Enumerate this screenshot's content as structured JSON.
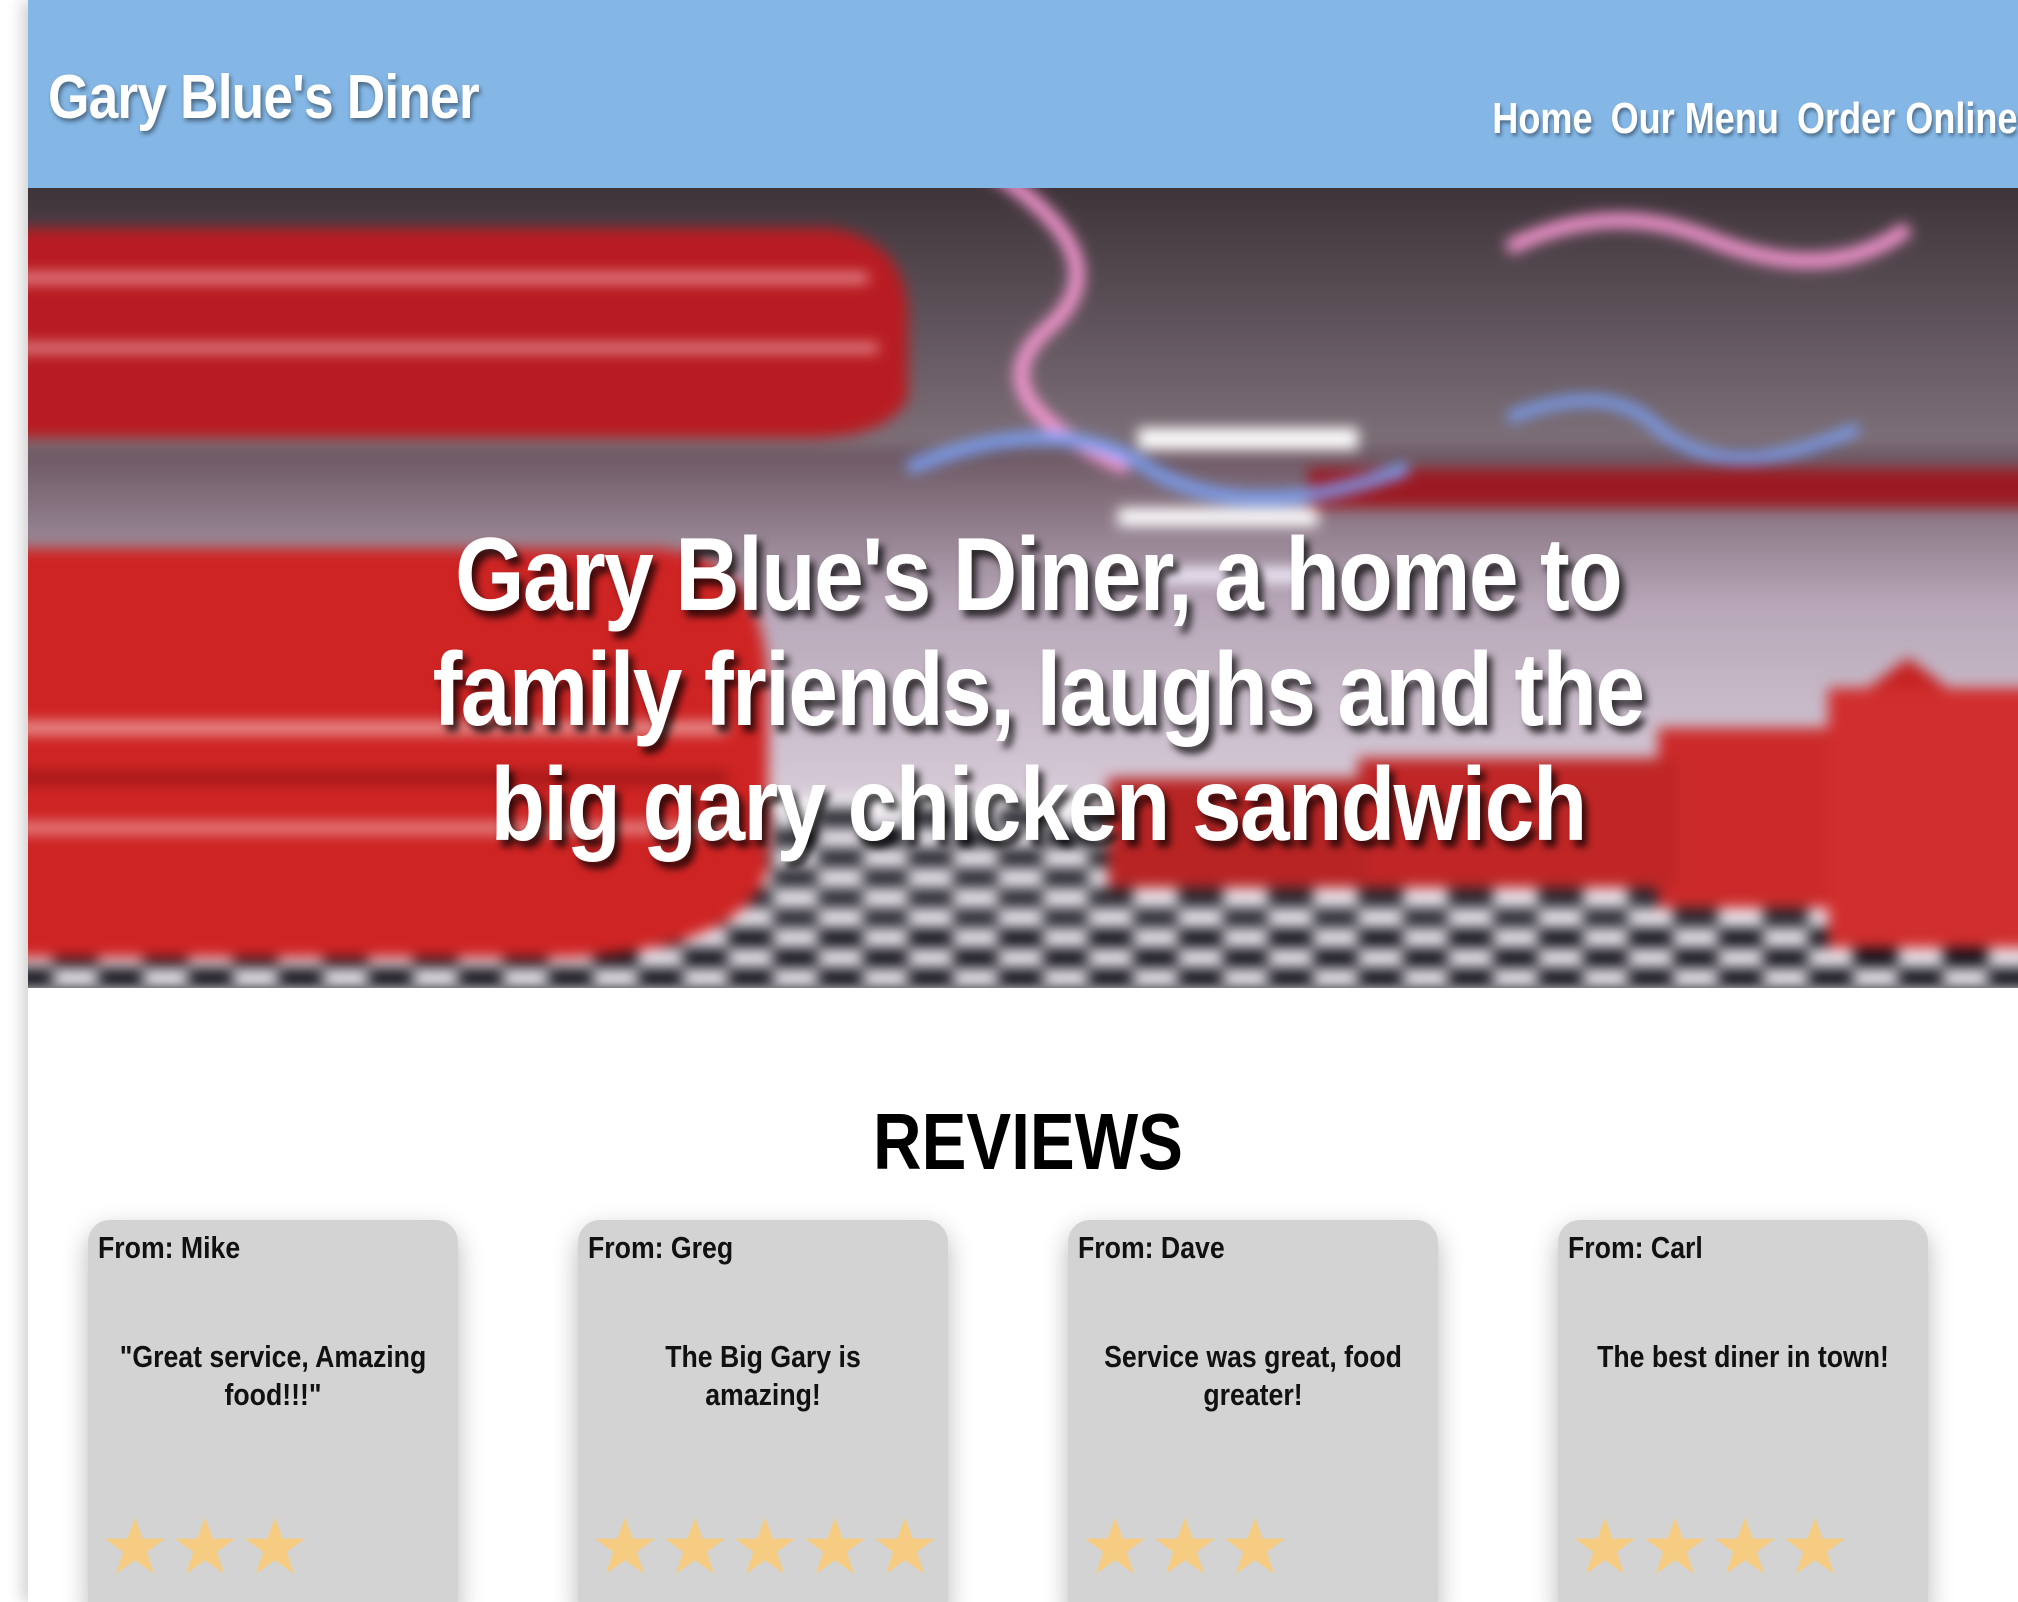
{
  "header": {
    "brand": "Gary Blue's Diner",
    "nav": [
      "Home",
      "Our Menu",
      "Order Online"
    ]
  },
  "hero": {
    "headline": "Gary Blue's Diner, a home to family friends, laughs and the big gary chicken sandwich"
  },
  "reviews": {
    "title": "REVIEWS",
    "items": [
      {
        "from": "From: Mike",
        "text": "\"Great service, Amazing food!!!\"",
        "stars": 3
      },
      {
        "from": "From: Greg",
        "text": "The Big Gary is amazing!",
        "stars": 5
      },
      {
        "from": "From: Dave",
        "text": "Service was great, food greater!",
        "stars": 3
      },
      {
        "from": "From: Carl",
        "text": "The best diner in town!",
        "stars": 4
      }
    ]
  },
  "colors": {
    "header_bg": "#84b7e6",
    "card_bg": "#d3d3d3",
    "star": "#f5cc82",
    "diner_red": "#cf2424"
  },
  "icons": {
    "rating": "star-icon"
  }
}
